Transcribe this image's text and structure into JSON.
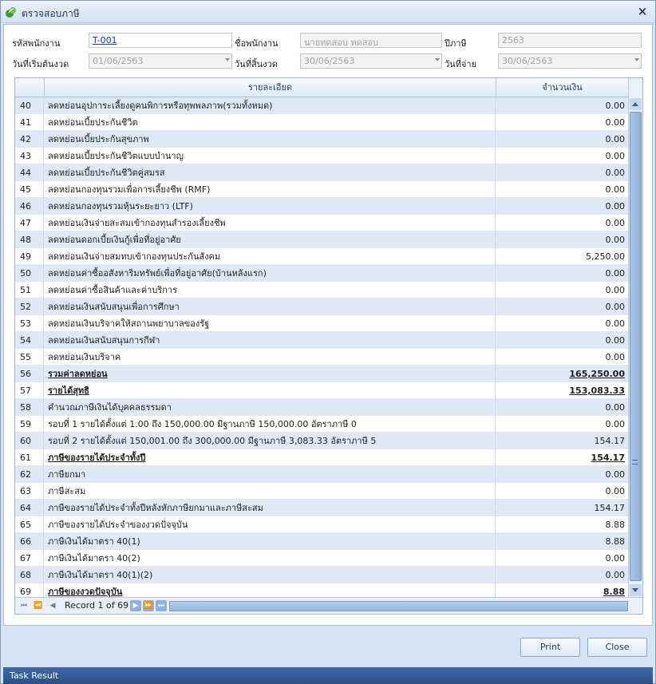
{
  "window": {
    "title": "ตรวจสอบภาษี",
    "close_label": "×"
  },
  "form": {
    "emp_code_label": "รหัสพนักงาน",
    "emp_code": "T-001",
    "emp_name_label": "ชื่อพนักงาน",
    "emp_name": "นายทดสอบ ทดสอบ",
    "tax_year_label": "ปีภาษี",
    "tax_year": "2563",
    "start_label": "วันที่เริ่มต้นงวด",
    "start_date": "01/06/2563",
    "end_label": "วันที่สิ้นงวด",
    "end_date": "30/06/2563",
    "pay_label": "วันที่จ่าย",
    "pay_date": "30/06/2563"
  },
  "grid": {
    "col_desc": "รายละเอียด",
    "col_amount": "จำนวนเงิน",
    "rows": [
      {
        "no": "40",
        "desc": "ลดหย่อนอุปการะเลี้ยงดูคนพิการหรือทุพพลภาพ(รวมทั้งหมด)",
        "amount": "0.00"
      },
      {
        "no": "41",
        "desc": "ลดหย่อนเบี้ยประกันชีวิต",
        "amount": "0.00"
      },
      {
        "no": "42",
        "desc": "ลดหย่อนเบี้ยประกันสุขภาพ",
        "amount": "0.00"
      },
      {
        "no": "43",
        "desc": "ลดหย่อนเบี้ยประกันชีวิตแบบบำนาญ",
        "amount": "0.00"
      },
      {
        "no": "44",
        "desc": "ลดหย่อนเบี้ยประกันชีวิตคู่สมรส",
        "amount": "0.00"
      },
      {
        "no": "45",
        "desc": "ลดหย่อนกองทุนรวมเพื่อการเลี้ยงชีพ (RMF)",
        "amount": "0.00"
      },
      {
        "no": "46",
        "desc": "ลดหย่อนกองทุนรวมหุ้นระยะยาว (LTF)",
        "amount": "0.00"
      },
      {
        "no": "47",
        "desc": "ลดหย่อนเงินจ่ายสะสมเข้ากองทุนสำรองเลี้ยงชีพ",
        "amount": "0.00"
      },
      {
        "no": "48",
        "desc": "ลดหย่อนดอกเบี้ยเงินกู้เพื่อที่อยู่อาศัย",
        "amount": "0.00"
      },
      {
        "no": "49",
        "desc": "ลดหย่อนเงินจ่ายสมทบเข้ากองทุนประกันสังคม",
        "amount": "5,250.00"
      },
      {
        "no": "50",
        "desc": "ลดหย่อนค่าซื้ออสังหาริมทรัพย์เพื่อที่อยู่อาศัย(บ้านหลังแรก)",
        "amount": "0.00"
      },
      {
        "no": "51",
        "desc": "ลดหย่อนค่าซื้อสินค้าและค่าบริการ",
        "amount": "0.00"
      },
      {
        "no": "52",
        "desc": "ลดหย่อนเงินสนับสนุนเพื่อการศึกษา",
        "amount": "0.00"
      },
      {
        "no": "53",
        "desc": "ลดหย่อนเงินบริจาคให้สถานพยาบาลของรัฐ",
        "amount": "0.00"
      },
      {
        "no": "54",
        "desc": "ลดหย่อนเงินสนับสนุนการกีฬา",
        "amount": "0.00"
      },
      {
        "no": "55",
        "desc": "ลดหย่อนเงินบริจาค",
        "amount": "0.00"
      },
      {
        "no": "56",
        "desc": "รวมค่าลดหย่อน",
        "amount": "165,250.00",
        "bold": true
      },
      {
        "no": "57",
        "desc": "รายได้สุทธิ",
        "amount": "153,083.33",
        "bold": true
      },
      {
        "no": "58",
        "desc": "คำนวณภาษีเงินได้บุคคลธรรมดา",
        "amount": "0.00"
      },
      {
        "no": "59",
        "desc": "รอบที่  1 รายได้ตั้งแต่ 1.00 ถึง 150,000.00 มีฐานภาษี 150,000.00 อัตราภาษี  0",
        "amount": "0.00"
      },
      {
        "no": "60",
        "desc": "รอบที่  2 รายได้ตั้งแต่ 150,001.00 ถึง 300,000.00 มีฐานภาษี 3,083.33 อัตราภาษี 5",
        "amount": "154.17"
      },
      {
        "no": "61",
        "desc": "ภาษีของรายได้ประจำทั้งปี",
        "amount": "154.17",
        "bold": true
      },
      {
        "no": "62",
        "desc": "ภาษียกมา",
        "amount": "0.00"
      },
      {
        "no": "63",
        "desc": "ภาษีสะสม",
        "amount": "0.00"
      },
      {
        "no": "64",
        "desc": "ภาษีของรายได้ประจำทั้งปีหลังหักภาษียกมาและภาษีสะสม",
        "amount": "154.17"
      },
      {
        "no": "65",
        "desc": "ภาษีของรายได้ประจำของงวดปัจจุบัน",
        "amount": "8.88"
      },
      {
        "no": "66",
        "desc": "ภาษีเงินได้มาตรา 40(1)",
        "amount": "8.88"
      },
      {
        "no": "67",
        "desc": "ภาษีเงินได้มาตรา 40(2)",
        "amount": "0.00"
      },
      {
        "no": "68",
        "desc": "ภาษีเงินได้มาตรา 40(1)(2)",
        "amount": "0.00"
      },
      {
        "no": "69",
        "desc": "ภาษีของงวดปัจจุบัน",
        "amount": "8.88",
        "bold": true
      }
    ],
    "record_text": "Record 1 of 69"
  },
  "buttons": {
    "print": "Print",
    "close": "Close"
  },
  "status": {
    "task_result": "Task Result"
  },
  "colors": {
    "alt_row": "#dfe8f5",
    "header_bg": "#d5e3f4",
    "taskbar": "#2a4f86"
  }
}
